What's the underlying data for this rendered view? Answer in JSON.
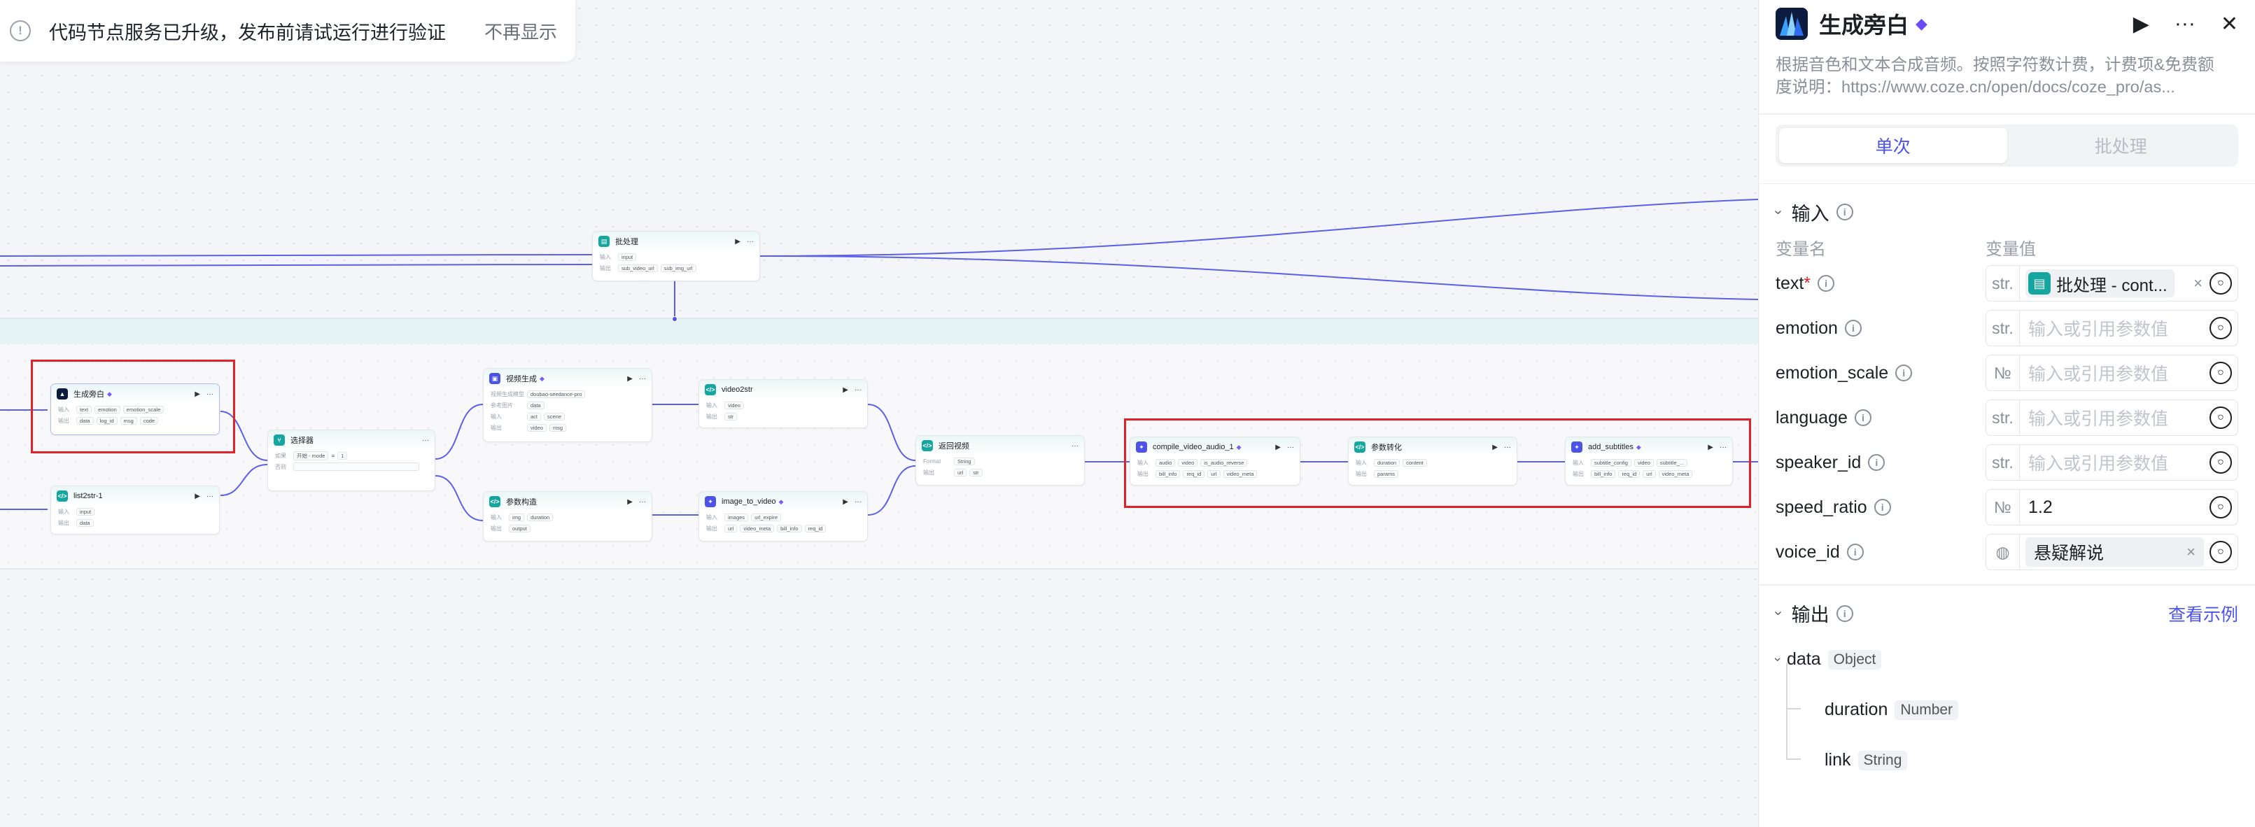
{
  "notice": {
    "message": "代码节点服务已升级，发布前请试运行进行验证",
    "dismiss": "不再显示"
  },
  "nodes": {
    "batch": {
      "title": "批处理",
      "in_label": "输入",
      "out_label": "输出",
      "in": [
        "input"
      ],
      "out": [
        "sub_video_url",
        "sub_img_url"
      ]
    },
    "narration": {
      "title": "生成旁白",
      "in_label": "输入",
      "out_label": "输出",
      "in": [
        "text",
        "emotion",
        "emotion_scale"
      ],
      "out": [
        "data",
        "log_id",
        "msg",
        "code"
      ]
    },
    "list2str": {
      "title": "list2str-1",
      "in_label": "输入",
      "out_label": "输出",
      "in": [
        "input"
      ],
      "out": [
        "data"
      ]
    },
    "selector": {
      "title": "选择器",
      "cond_label": "如果",
      "else_label": "否则",
      "cond_left": "开始 - mode",
      "cond_op": "=",
      "cond_right": "1"
    },
    "video_gen": {
      "title": "视频生成",
      "model_label": "视频生成模型",
      "model": "doubao-seedance-pro",
      "ref_label": "参考图片",
      "ref": "data",
      "in_label": "输入",
      "out_label": "输出",
      "in": [
        "act",
        "scene"
      ],
      "out": [
        "video",
        "msg"
      ]
    },
    "video2str": {
      "title": "video2str",
      "in_label": "输入",
      "out_label": "输出",
      "in": [
        "video"
      ],
      "out": [
        "str"
      ]
    },
    "param_build": {
      "title": "参数构造",
      "in_label": "输入",
      "out_label": "输出",
      "in": [
        "img",
        "duration"
      ],
      "out": [
        "output"
      ]
    },
    "image_to_video": {
      "title": "image_to_video",
      "in_label": "输入",
      "out_label": "输出",
      "in": [
        "images",
        "url_expire"
      ],
      "out": [
        "url",
        "video_meta",
        "bill_info",
        "req_id"
      ]
    },
    "return_video": {
      "title": "返回视频",
      "fmt_label": "Format",
      "fmt": "String",
      "out_label": "输出",
      "out": [
        "url",
        "str"
      ]
    },
    "compile": {
      "title": "compile_video_audio_1",
      "in_label": "输入",
      "out_label": "输出",
      "in": [
        "audio",
        "video",
        "is_audio_reverse"
      ],
      "out": [
        "bill_info",
        "req_id",
        "url",
        "video_meta"
      ]
    },
    "param_convert": {
      "title": "参数转化",
      "in_label": "输入",
      "out_label": "输出",
      "in": [
        "duration",
        "content"
      ],
      "out": [
        "params"
      ]
    },
    "add_subtitles": {
      "title": "add_subtitles",
      "in_label": "输入",
      "out_label": "输出",
      "in": [
        "subtitle_config",
        "video",
        "subtitle_..."
      ],
      "out": [
        "bill_info",
        "req_id",
        "url",
        "video_meta"
      ]
    }
  },
  "panel": {
    "title": "生成旁白",
    "description_lines": [
      "根据音色和文本合成音频。按照字符数计费，计费项&免费额",
      "度说明：https://www.coze.cn/open/docs/coze_pro/as..."
    ],
    "tabs": [
      {
        "label": "单次",
        "active": true
      },
      {
        "label": "批处理",
        "active": false
      }
    ],
    "input_section": "输入",
    "col_name": "变量名",
    "col_value": "变量值",
    "params": [
      {
        "name": "text",
        "required": true,
        "type": "str.",
        "ref": "批处理 - cont...",
        "placeholder": ""
      },
      {
        "name": "emotion",
        "required": false,
        "type": "str.",
        "placeholder": "输入或引用参数值"
      },
      {
        "name": "emotion_scale",
        "required": false,
        "type": "№",
        "placeholder": "输入或引用参数值"
      },
      {
        "name": "language",
        "required": false,
        "type": "str.",
        "placeholder": "输入或引用参数值"
      },
      {
        "name": "speaker_id",
        "required": false,
        "type": "str.",
        "placeholder": "输入或引用参数值"
      },
      {
        "name": "speed_ratio",
        "required": false,
        "type": "№",
        "value": "1.2"
      },
      {
        "name": "voice_id",
        "required": false,
        "type": "voice",
        "voice": "悬疑解说"
      }
    ],
    "output_section": "输出",
    "output_link": "查看示例",
    "outputs": [
      {
        "name": "data",
        "type": "Object"
      },
      {
        "name": "duration",
        "type": "Number"
      },
      {
        "name": "link",
        "type": "String"
      }
    ]
  },
  "colors": {
    "accent": "#4d53e8",
    "highlight": "#e0222a",
    "teal": "#16a6a0",
    "gem": "#6a4cf5"
  }
}
